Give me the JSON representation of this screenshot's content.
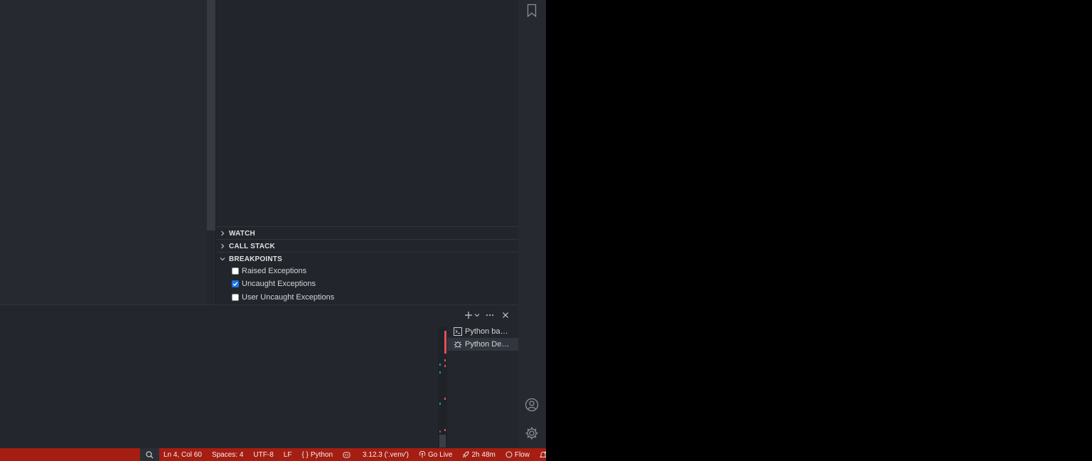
{
  "sidebar": {
    "sections": {
      "watch": "WATCH",
      "call_stack": "CALL STACK",
      "breakpoints": "BREAKPOINTS"
    },
    "breakpoints": [
      {
        "label": "Raised Exceptions",
        "checked": false
      },
      {
        "label": "Uncaught Exceptions",
        "checked": true
      },
      {
        "label": "User Uncaught Exceptions",
        "checked": false
      }
    ]
  },
  "panel": {
    "terminals": [
      {
        "label": "Python bas…",
        "icon": "terminal-icon"
      },
      {
        "label": "Python De…",
        "icon": "debug-icon"
      }
    ]
  },
  "statusbar": {
    "position": "Ln 4, Col 60",
    "indent": "Spaces: 4",
    "encoding": "UTF-8",
    "eol": "LF",
    "language": "Python",
    "interpreter": "3.12.3 ('.venv')",
    "live": "Go Live",
    "time": "2h 48m",
    "flow": "Flow"
  },
  "colors": {
    "statusbar": "#a61d12",
    "accent": "#1a73e8",
    "error_marker": "#e05252",
    "info_marker": "#2a8ab8"
  }
}
